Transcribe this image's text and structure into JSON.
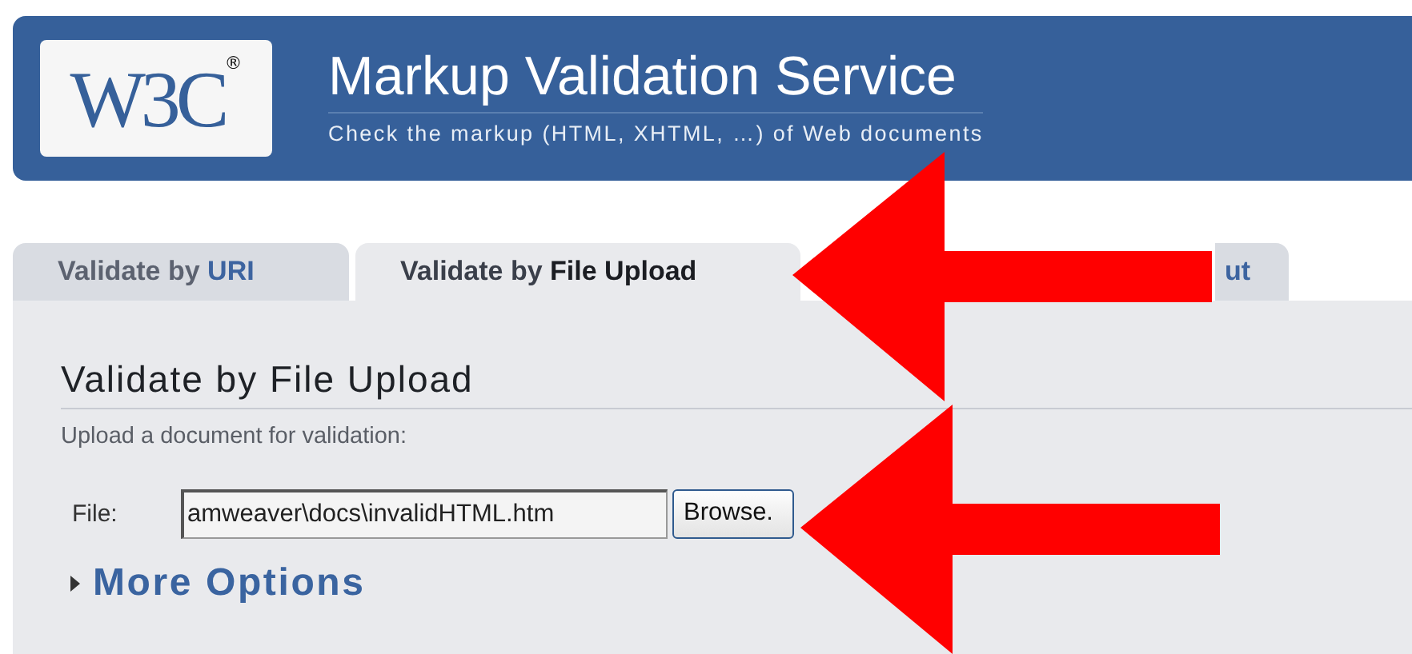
{
  "header": {
    "logo": "W3C",
    "logo_mark": "®",
    "title": "Markup Validation Service",
    "subtitle": "Check the markup (HTML, XHTML, …) of Web documents"
  },
  "tabs": [
    {
      "label": "Validate by",
      "term": "URI",
      "selected": false
    },
    {
      "label": "Validate by",
      "term": "File Upload",
      "selected": true
    },
    {
      "term": "ut",
      "selected": false
    }
  ],
  "panel": {
    "heading": "Validate by File Upload",
    "intro": "Upload a document for validation:",
    "file_label": "File:",
    "file_value": "amweaver\\docs\\invalidHTML.htm",
    "browse_button": "Browse.",
    "more_options": "More Options",
    "more_expanded": false
  },
  "annotations": [
    {
      "kind": "arrow"
    },
    {
      "kind": "arrow"
    }
  ]
}
